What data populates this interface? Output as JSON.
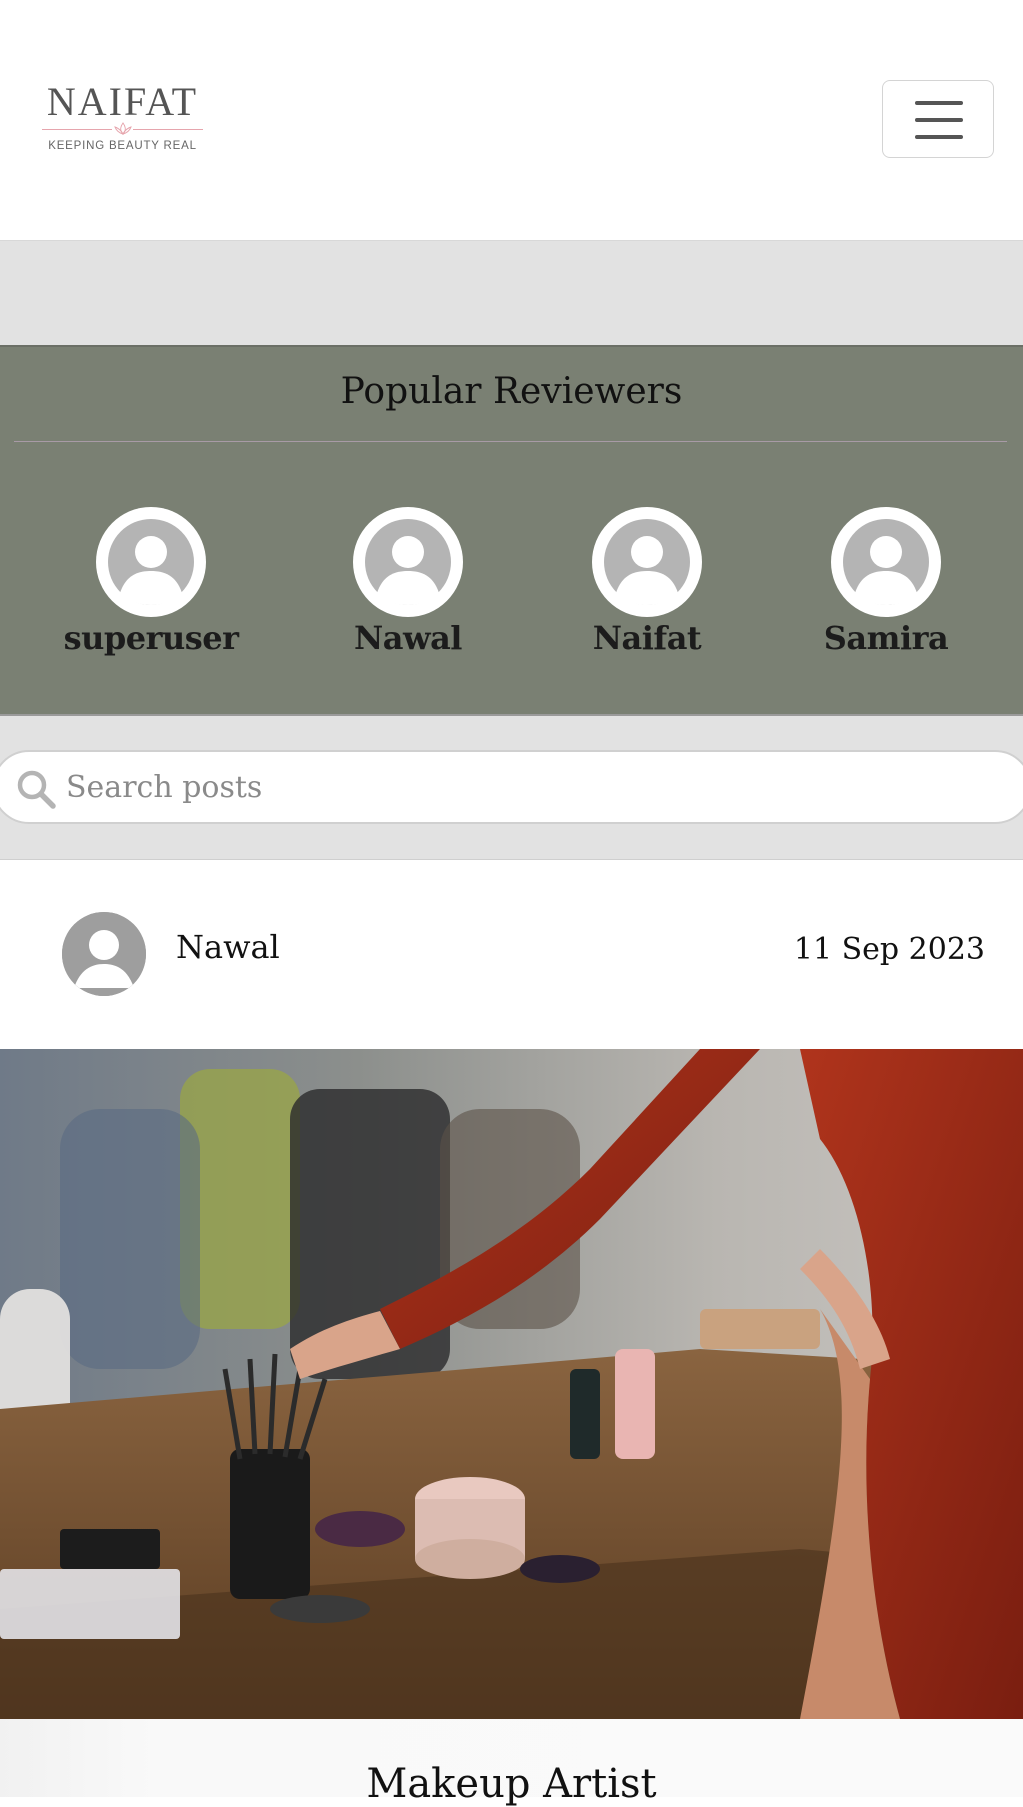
{
  "header": {
    "brand_name": "NAIFAT",
    "brand_tagline": "KEEPING BEAUTY REAL"
  },
  "popular_reviewers": {
    "title": "Popular Reviewers",
    "items": [
      {
        "name": "superuser"
      },
      {
        "name": "Nawal"
      },
      {
        "name": "Naifat"
      },
      {
        "name": "Samira"
      }
    ]
  },
  "search": {
    "placeholder": "Search posts",
    "value": ""
  },
  "post": {
    "author": "Nawal",
    "date": "11 Sep 2023",
    "title": "Makeup Artist"
  },
  "colors": {
    "reviewers_bg": "#7a8073",
    "band_bg": "#e2e2e2"
  }
}
